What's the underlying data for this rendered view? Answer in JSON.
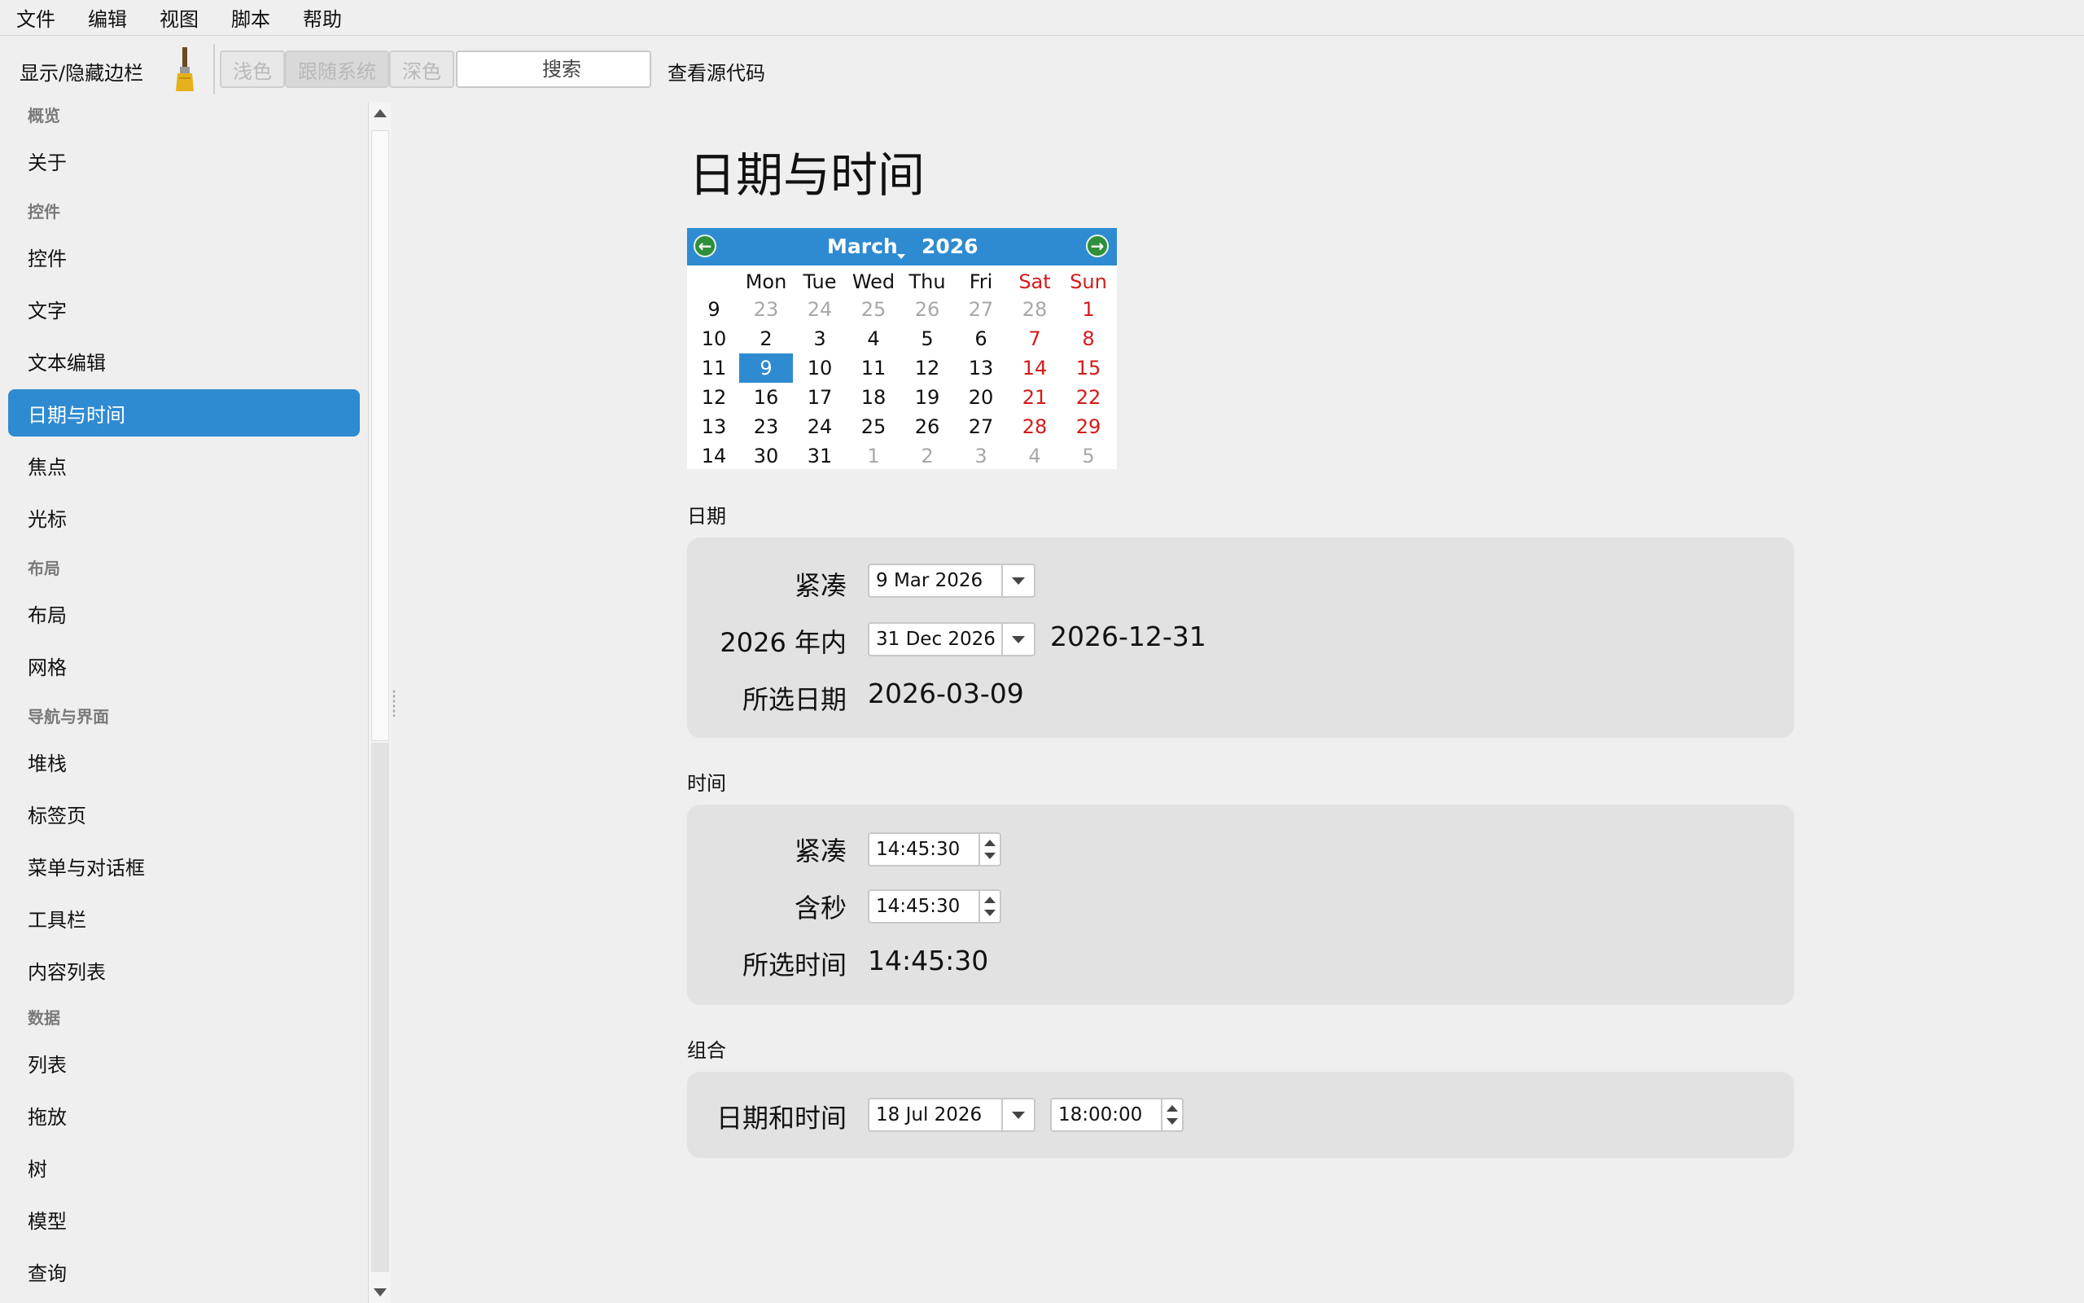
{
  "menubar": [
    "文件",
    "编辑",
    "视图",
    "脚本",
    "帮助"
  ],
  "toolbar": {
    "toggle_sidebar": "显示/隐藏边栏",
    "theme_light": "浅色",
    "theme_system": "跟随系统",
    "theme_dark": "深色",
    "search_placeholder": "搜索",
    "view_source": "查看源代码"
  },
  "sidebar": {
    "sections": [
      {
        "header": "概览",
        "items": [
          "关于"
        ]
      },
      {
        "header": "控件",
        "items": [
          "控件",
          "文字",
          "文本编辑",
          "日期与时间",
          "焦点",
          "光标"
        ]
      },
      {
        "header": "布局",
        "items": [
          "布局",
          "网格"
        ]
      },
      {
        "header": "导航与界面",
        "items": [
          "堆栈",
          "标签页",
          "菜单与对话框",
          "工具栏",
          "内容列表"
        ]
      },
      {
        "header": "数据",
        "items": [
          "列表",
          "拖放",
          "树",
          "模型",
          "查询"
        ]
      }
    ],
    "active_item": "日期与时间"
  },
  "page": {
    "title": "日期与时间"
  },
  "calendar": {
    "month": "March",
    "year": "2026",
    "weekdays": [
      "Mon",
      "Tue",
      "Wed",
      "Thu",
      "Fri",
      "Sat",
      "Sun"
    ],
    "weeks": [
      {
        "num": "9",
        "days": [
          "23",
          "24",
          "25",
          "26",
          "27",
          "28",
          "1"
        ]
      },
      {
        "num": "10",
        "days": [
          "2",
          "3",
          "4",
          "5",
          "6",
          "7",
          "8"
        ]
      },
      {
        "num": "11",
        "days": [
          "9",
          "10",
          "11",
          "12",
          "13",
          "14",
          "15"
        ]
      },
      {
        "num": "12",
        "days": [
          "16",
          "17",
          "18",
          "19",
          "20",
          "21",
          "22"
        ]
      },
      {
        "num": "13",
        "days": [
          "23",
          "24",
          "25",
          "26",
          "27",
          "28",
          "29"
        ]
      },
      {
        "num": "14",
        "days": [
          "30",
          "31",
          "1",
          "2",
          "3",
          "4",
          "5"
        ]
      }
    ],
    "selected": "9",
    "accent_color": "#2f8bd1",
    "weekend_color": "#d61a1a"
  },
  "date_section": {
    "label": "日期",
    "compact_label": "紧凑",
    "compact_value": "9 Mar 2026",
    "within_year_label": "2026 年内",
    "within_year_value": "31 Dec 2026",
    "within_year_iso": "2026-12-31",
    "selected_label": "所选日期",
    "selected_value": "2026-03-09"
  },
  "time_section": {
    "label": "时间",
    "compact_label": "紧凑",
    "compact_value": "14:45:30",
    "seconds_label": "含秒",
    "seconds_value": "14:45:30",
    "selected_label": "所选时间",
    "selected_value": "14:45:30"
  },
  "combo_section": {
    "label": "组合",
    "datetime_label": "日期和时间",
    "date_value": "18 Jul 2026",
    "time_value": "18:00:00"
  }
}
